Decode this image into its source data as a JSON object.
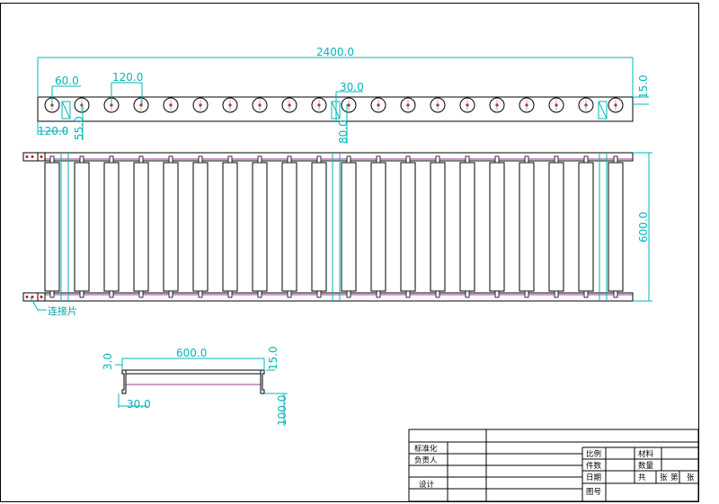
{
  "colors": {
    "dimension": "#00b7b7",
    "frame": "#000000",
    "rail_accent": "#9b3a9b",
    "hole": "#c01818",
    "tick": "#7a7a7a"
  },
  "roller_count": 20,
  "dimensions": {
    "total_length": "2400.0",
    "pitch": "60.0",
    "roller_spacing": "120.0",
    "joint_gap": "30.0",
    "rail_height_top": "15.0",
    "end_offset": "120.0",
    "hole_height": "55.0",
    "joint_height": "80.0",
    "width": "600.0",
    "section_width": "600.0",
    "section_top_offset": "3.0",
    "section_right_top": "15.0",
    "section_bottom": "30.0",
    "section_height": "100.0"
  },
  "annotations": {
    "connector": "连接片"
  },
  "title_block": {
    "standardization": "标准化",
    "responsible": "负责人",
    "design": "设计",
    "scale": "比例",
    "pieces": "件数",
    "date": "日期",
    "drawing_no": "图号",
    "material": "材料",
    "quantity": "数量",
    "total_sheets": "共",
    "sheets_unit_1": "张",
    "sheet_no": "第",
    "sheets_unit_2": "张"
  }
}
